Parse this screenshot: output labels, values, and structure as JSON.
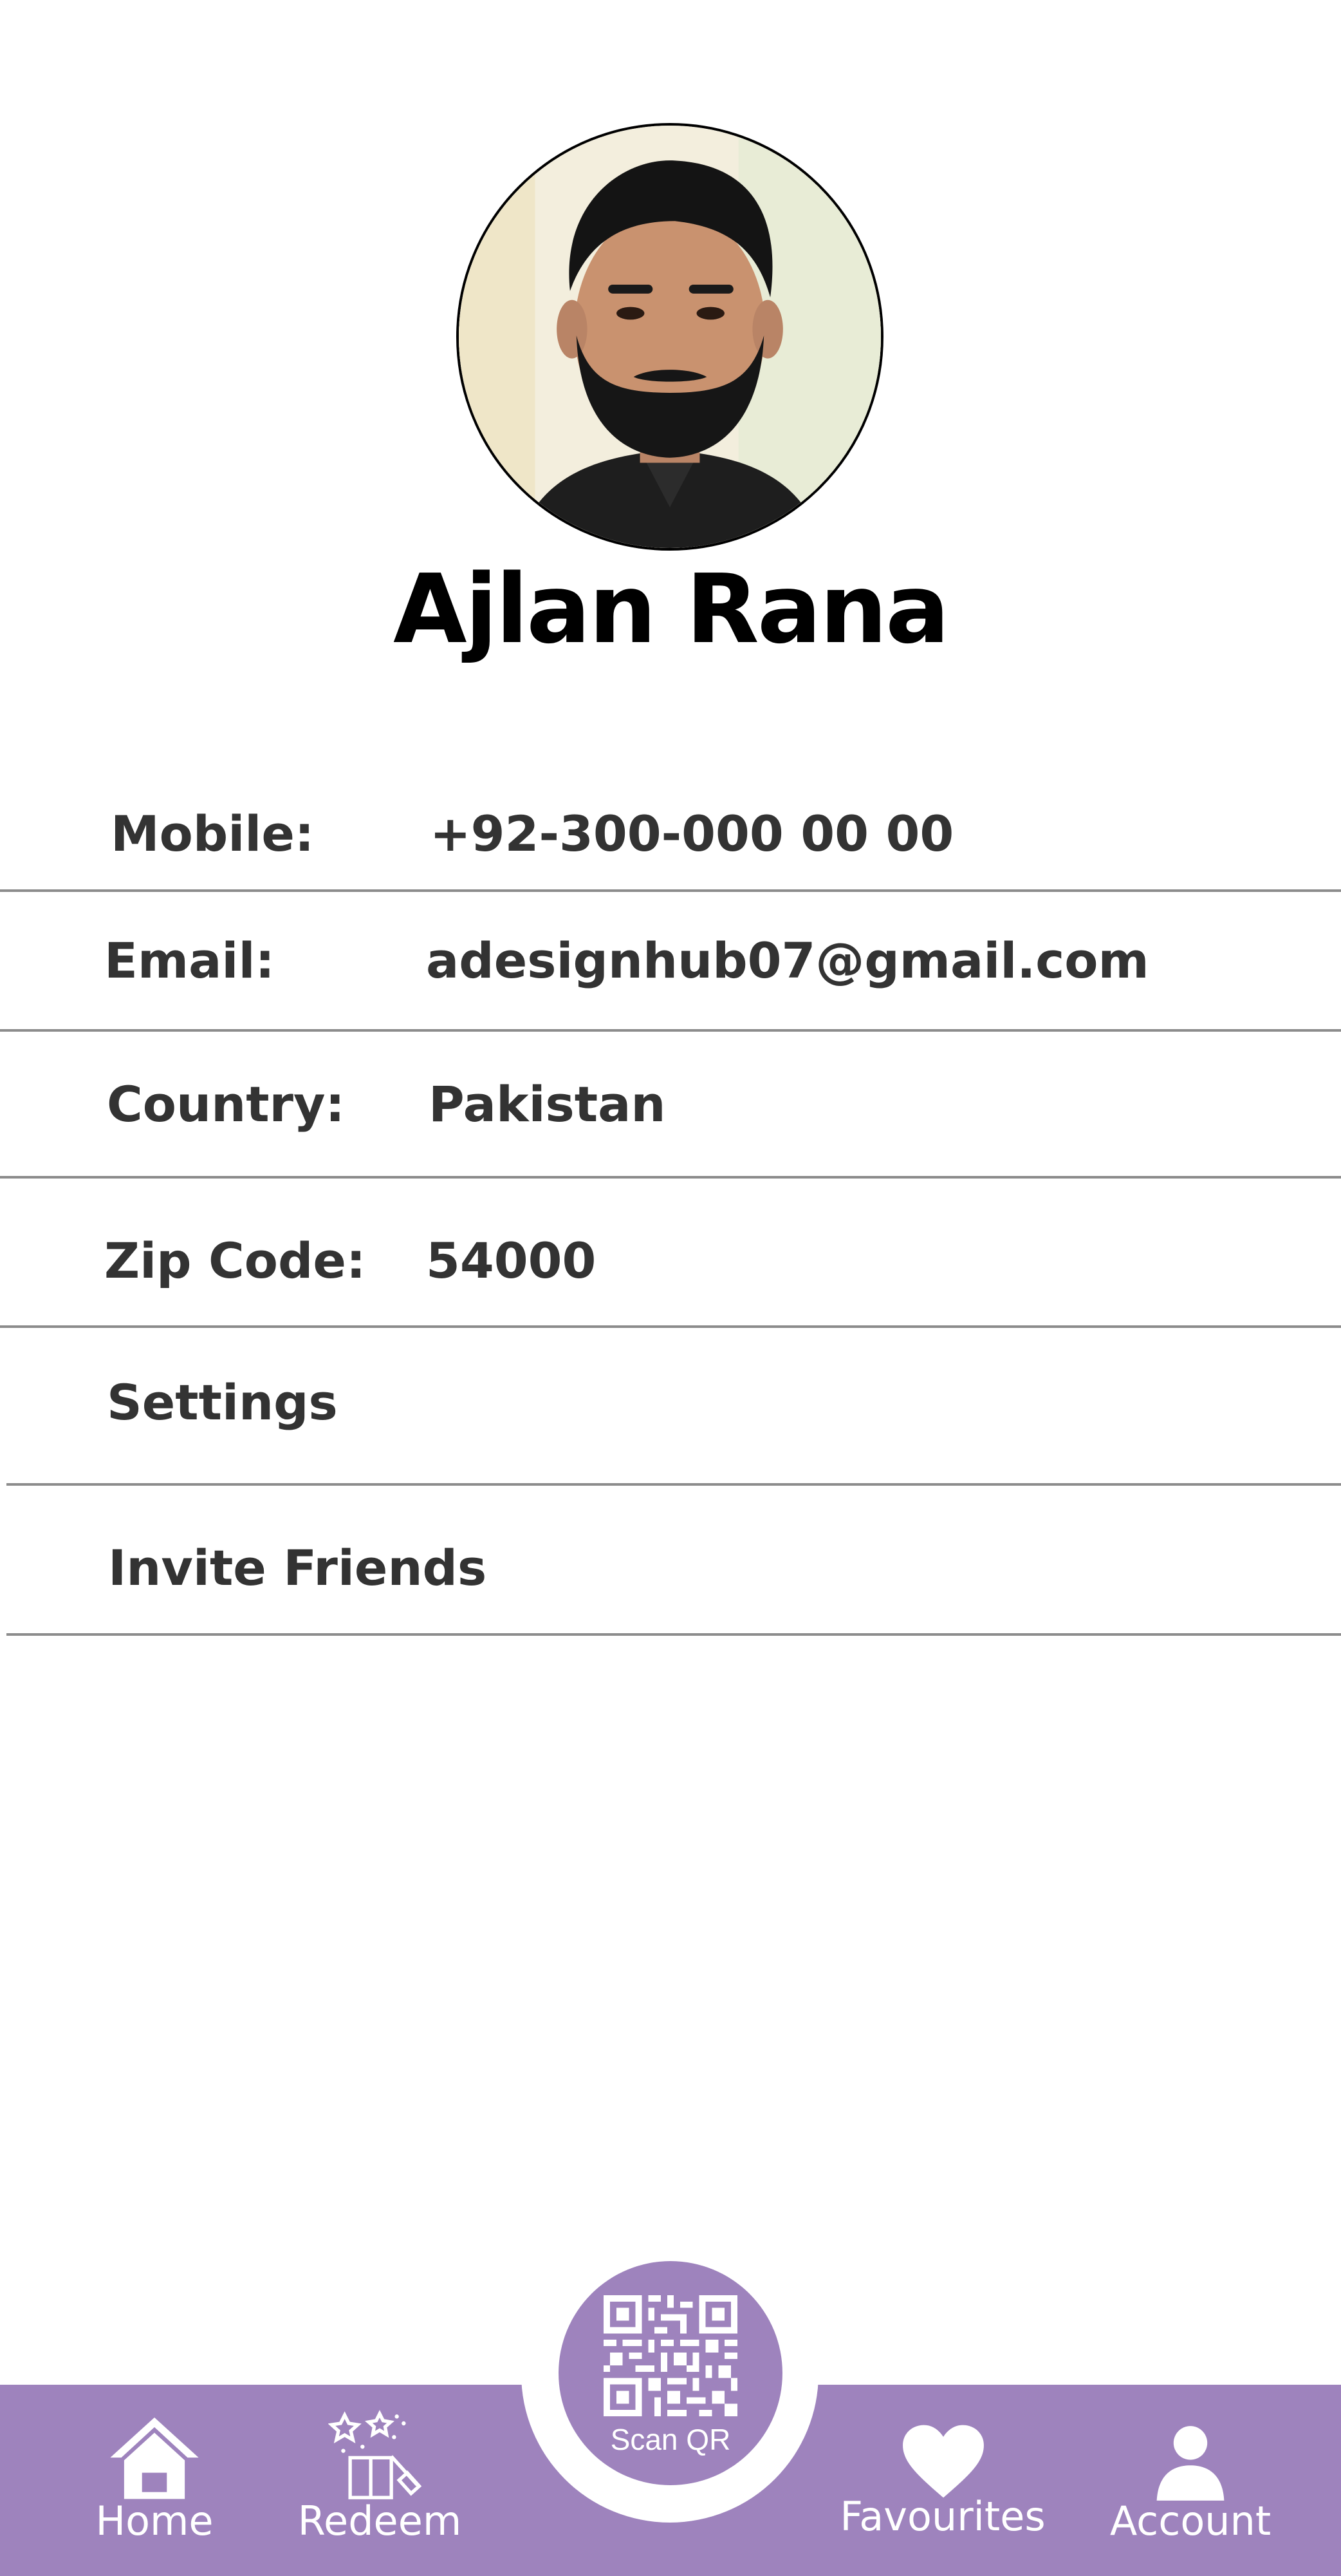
{
  "profile": {
    "name": "Ajlan Rana"
  },
  "details": [
    {
      "label": "Mobile:",
      "value": "+92-300-000 00 00"
    },
    {
      "label": "Email:",
      "value": "adesignhub07@gmail.com"
    },
    {
      "label": "Country:",
      "value": "Pakistan"
    },
    {
      "label": "Zip Code:",
      "value": "54000"
    }
  ],
  "menu": [
    {
      "label": "Settings"
    },
    {
      "label": "Invite Friends"
    }
  ],
  "nav": {
    "home": "Home",
    "redeem": "Redeem",
    "scan": "Scan QR",
    "favourites": "Favourites",
    "account": "Account"
  },
  "colors": {
    "accent": "#9e83bd",
    "text": "#333333",
    "divider": "#8c8c8c"
  }
}
